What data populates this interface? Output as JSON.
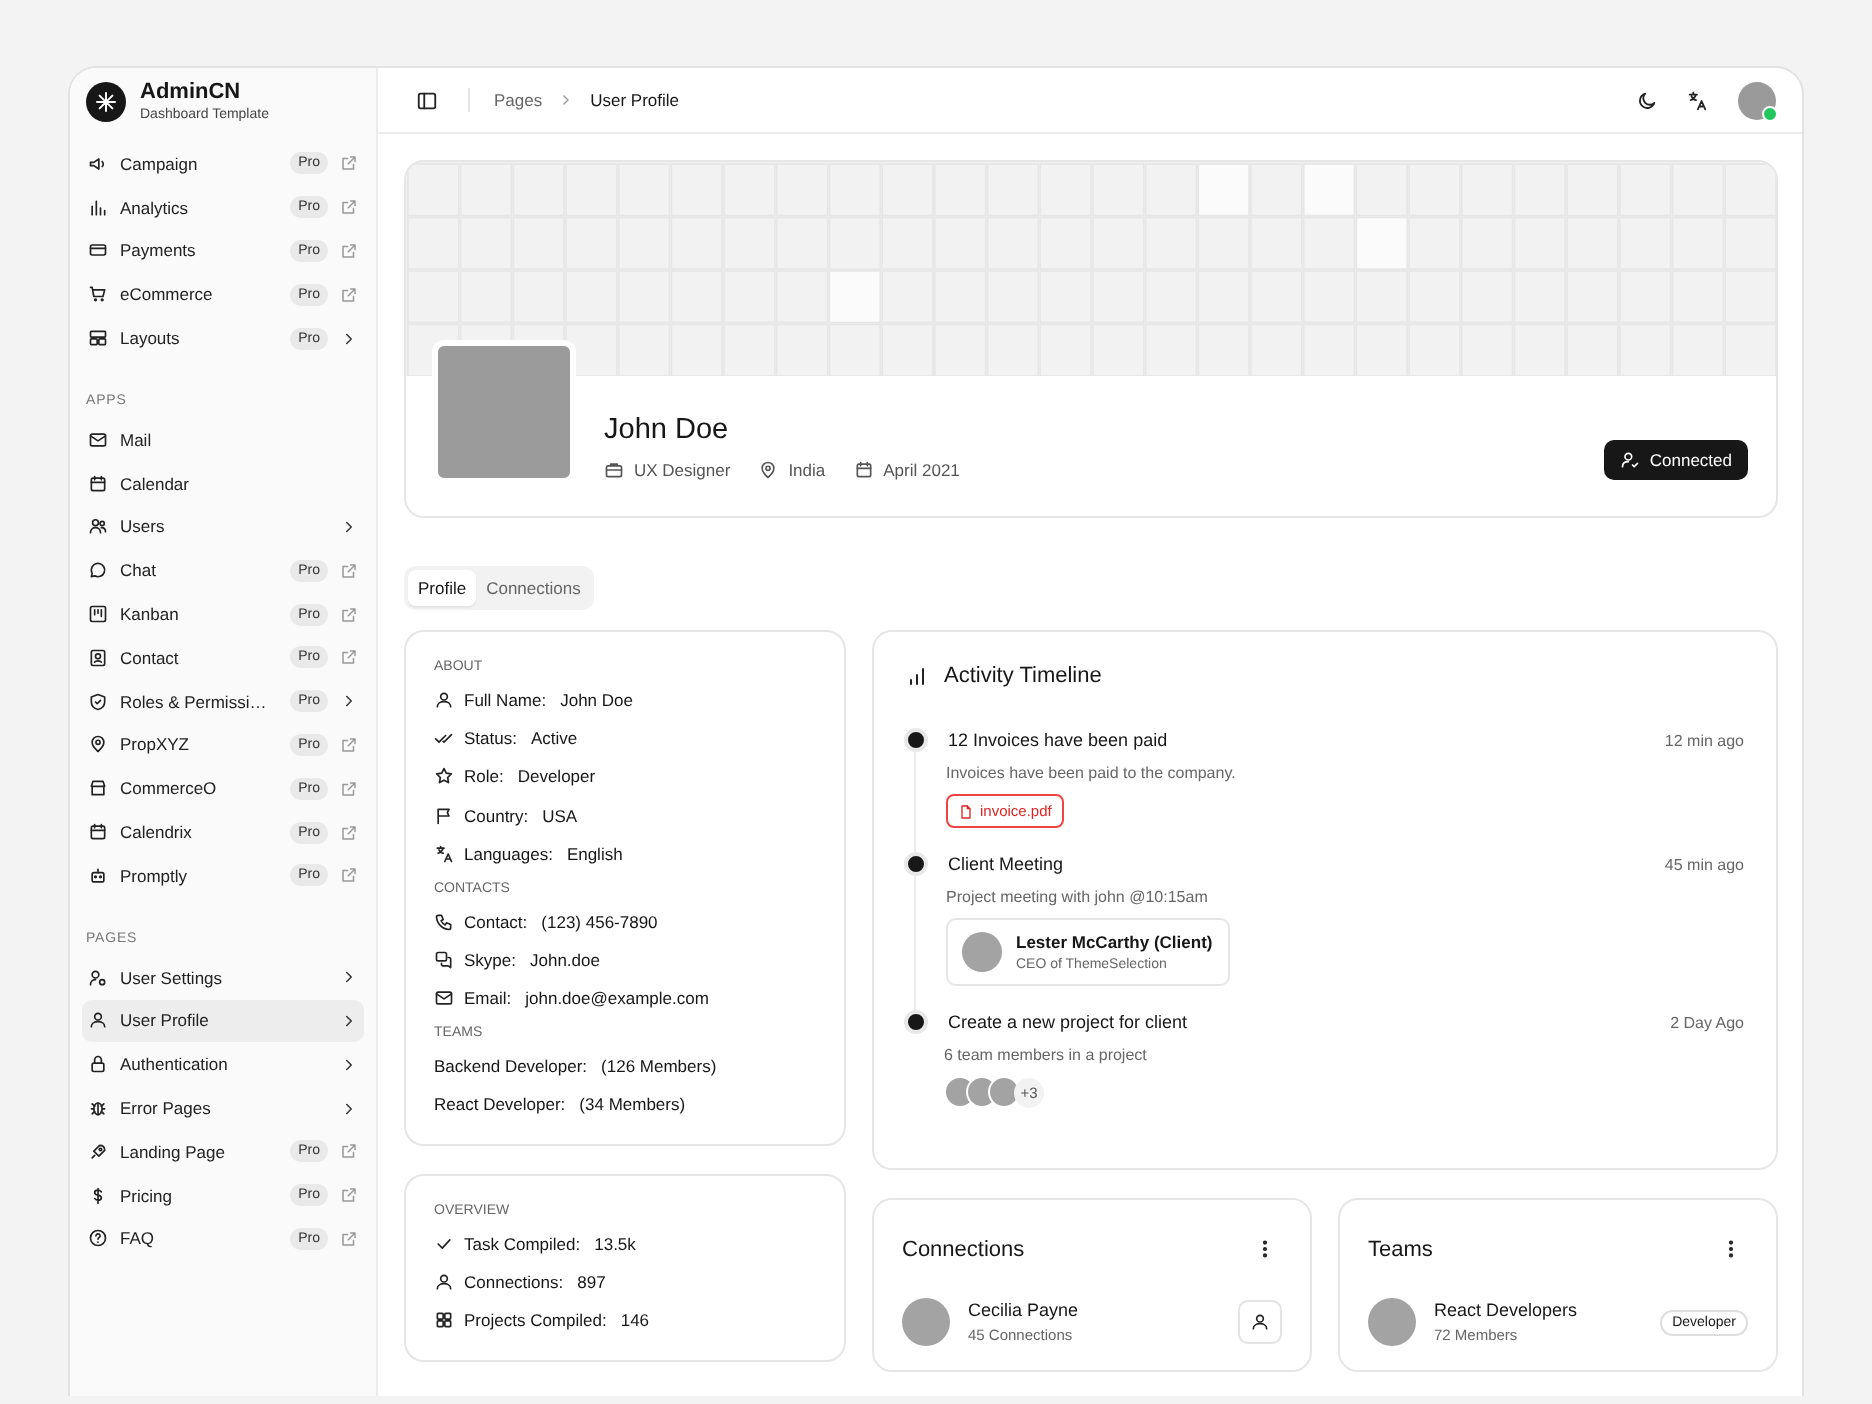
{
  "brand": {
    "name": "AdminCN",
    "subtitle": "Dashboard Template"
  },
  "sidebar": {
    "sections": [
      {
        "items": [
          {
            "label": "Campaign",
            "badge": "Pro",
            "kind": "external",
            "selected": false
          },
          {
            "label": "Analytics",
            "badge": "Pro",
            "kind": "external",
            "selected": false
          },
          {
            "label": "Payments",
            "badge": "Pro",
            "kind": "external",
            "selected": false
          },
          {
            "label": "eCommerce",
            "badge": "Pro",
            "kind": "external",
            "selected": false
          },
          {
            "label": "Layouts",
            "badge": "Pro",
            "kind": "submenu",
            "selected": false
          }
        ]
      },
      {
        "heading": "APPS",
        "items": [
          {
            "label": "Mail",
            "kind": "plain",
            "selected": false
          },
          {
            "label": "Calendar",
            "kind": "plain",
            "selected": false
          },
          {
            "label": "Users",
            "kind": "submenu",
            "selected": false
          },
          {
            "label": "Chat",
            "badge": "Pro",
            "kind": "external",
            "selected": false
          },
          {
            "label": "Kanban",
            "badge": "Pro",
            "kind": "external",
            "selected": false
          },
          {
            "label": "Contact",
            "badge": "Pro",
            "kind": "external",
            "selected": false
          },
          {
            "label": "Roles & Permissi…",
            "badge": "Pro",
            "kind": "submenu",
            "selected": false
          },
          {
            "label": "PropXYZ",
            "badge": "Pro",
            "kind": "external",
            "selected": false
          },
          {
            "label": "CommerceO",
            "badge": "Pro",
            "kind": "external",
            "selected": false
          },
          {
            "label": "Calendrix",
            "badge": "Pro",
            "kind": "external",
            "selected": false
          },
          {
            "label": "Promptly",
            "badge": "Pro",
            "kind": "external",
            "selected": false
          }
        ]
      },
      {
        "heading": "PAGES",
        "items": [
          {
            "label": "User Settings",
            "kind": "submenu",
            "selected": false
          },
          {
            "label": "User Profile",
            "kind": "submenu",
            "selected": true
          },
          {
            "label": "Authentication",
            "kind": "submenu",
            "selected": false
          },
          {
            "label": "Error Pages",
            "kind": "submenu",
            "selected": false
          },
          {
            "label": "Landing Page",
            "badge": "Pro",
            "kind": "external",
            "selected": false
          },
          {
            "label": "Pricing",
            "badge": "Pro",
            "kind": "external",
            "selected": false
          },
          {
            "label": "FAQ",
            "badge": "Pro",
            "kind": "external",
            "selected": false
          }
        ]
      }
    ]
  },
  "header": {
    "breadcrumb": [
      "Pages",
      "User Profile"
    ],
    "user": {
      "online": true
    }
  },
  "profile": {
    "name": "John Doe",
    "meta": [
      "UX Designer",
      "India",
      "April 2021"
    ],
    "button": "Connected"
  },
  "tabs": [
    {
      "label": "Profile",
      "selected": true
    },
    {
      "label": "Connections",
      "selected": false
    }
  ],
  "about_card": {
    "sections": [
      {
        "heading": "ABOUT",
        "rows": [
          {
            "label": "Full Name:",
            "value": "John Doe"
          },
          {
            "label": "Status:",
            "value": "Active"
          },
          {
            "label": "Role:",
            "value": "Developer"
          },
          {
            "label": "Country:",
            "value": "USA"
          },
          {
            "label": "Languages:",
            "value": "English"
          }
        ]
      },
      {
        "heading": "CONTACTS",
        "rows": [
          {
            "label": "Contact:",
            "value": "(123) 456-7890"
          },
          {
            "label": "Skype:",
            "value": "John.doe"
          },
          {
            "label": "Email:",
            "value": "john.doe@example.com"
          }
        ]
      },
      {
        "heading": "TEAMS",
        "rows": [
          {
            "label": "Backend Developer:",
            "value": "(126 Members)"
          },
          {
            "label": "React Developer:",
            "value": "(34 Members)"
          }
        ]
      }
    ]
  },
  "overview_card": {
    "heading": "OVERVIEW",
    "rows": [
      {
        "label": "Task Compiled:",
        "value": "13.5k"
      },
      {
        "label": "Connections:",
        "value": "897"
      },
      {
        "label": "Projects Compiled:",
        "value": "146"
      }
    ]
  },
  "activity": {
    "title": "Activity Timeline",
    "events": [
      {
        "title": "12 Invoices have been paid",
        "time": "12 min ago",
        "description": "Invoices have been paid to the company.",
        "attachment": {
          "kind": "file",
          "label": "invoice.pdf"
        }
      },
      {
        "title": "Client Meeting",
        "time": "45 min ago",
        "description": "Project meeting with john @10:15am",
        "attachment": {
          "kind": "person",
          "name": "Lester McCarthy (Client)",
          "role": "CEO of ThemeSelection"
        }
      },
      {
        "title": "Create a new project for client",
        "time": "2 Day Ago",
        "description": "6 team members in a project",
        "attachment": {
          "kind": "avatars",
          "extra": "+3"
        }
      }
    ]
  },
  "connections": {
    "title": "Connections",
    "items": [
      {
        "name": "Cecilia Payne",
        "detail": "45 Connections"
      }
    ]
  },
  "teams": {
    "title": "Teams",
    "items": [
      {
        "name": "React Developers",
        "detail": "72 Members",
        "tag": "Developer"
      }
    ]
  }
}
